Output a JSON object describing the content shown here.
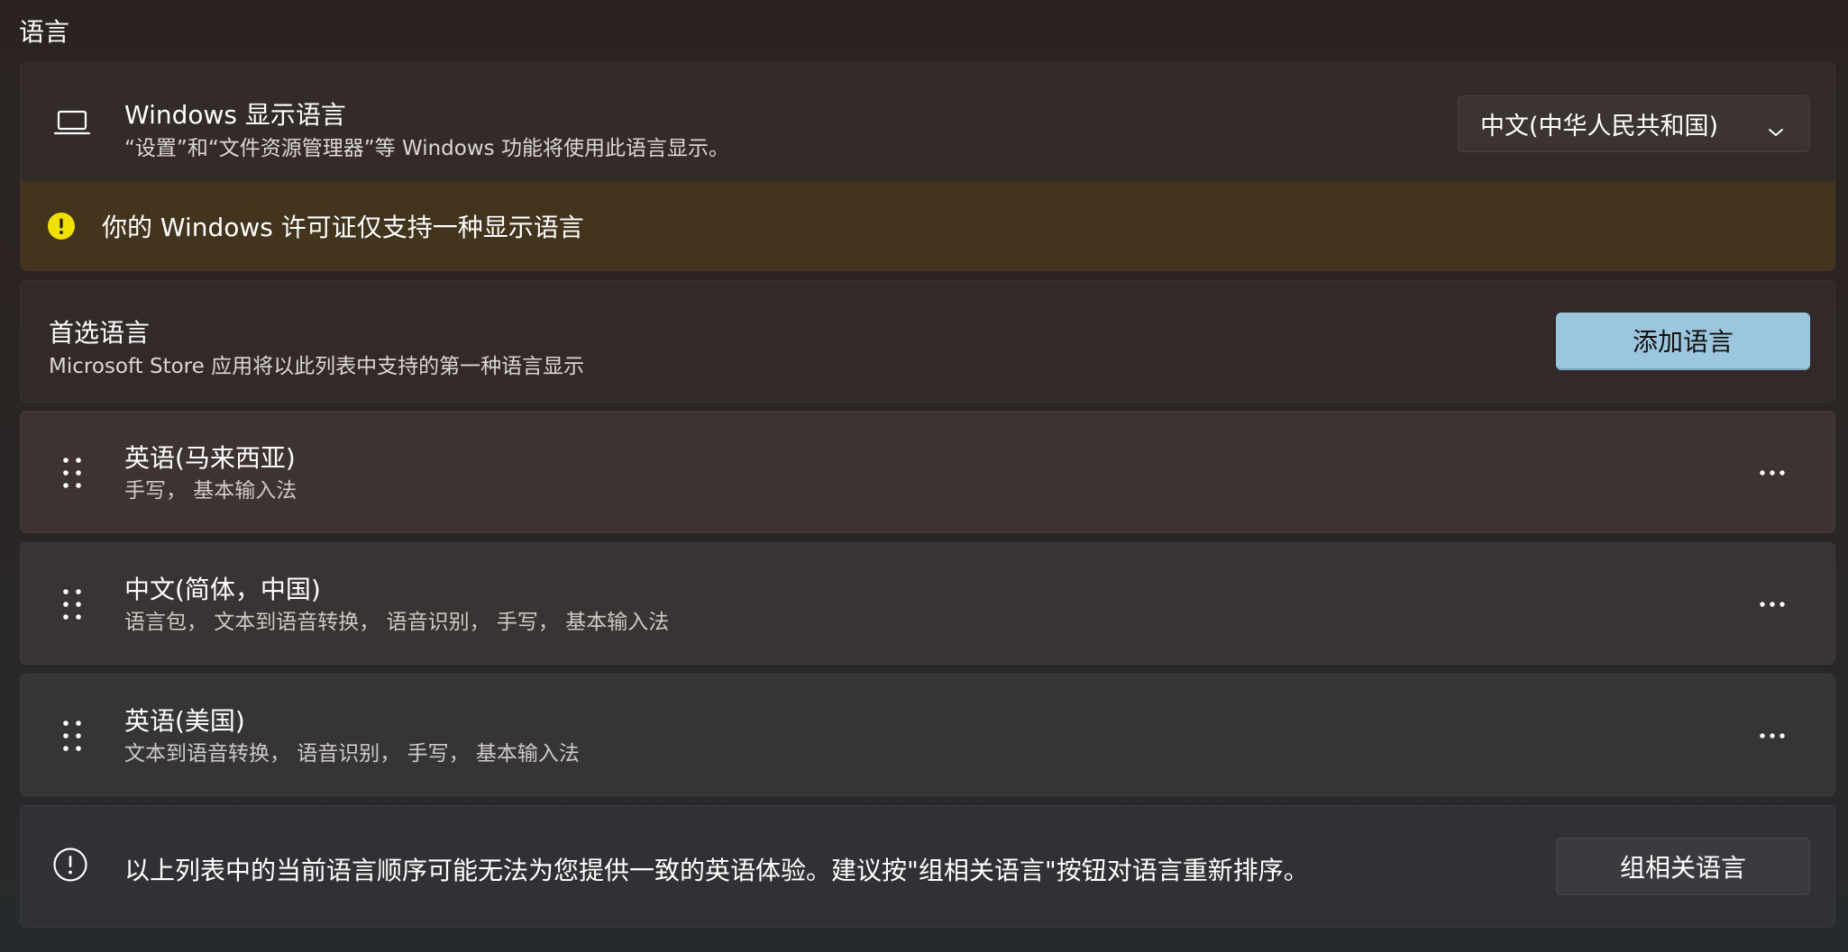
{
  "section": {
    "title": "语言"
  },
  "display_language": {
    "icon": "laptop-icon",
    "title": "Windows 显示语言",
    "description": "“设置”和“文件资源管理器”等 Windows 功能将使用此语言显示。",
    "selected": "中文(中华人民共和国)"
  },
  "license_warning": {
    "icon": "warning-icon",
    "text": "你的 Windows 许可证仅支持一种显示语言",
    "icon_color": "#f2e100"
  },
  "preferred": {
    "title": "首选语言",
    "description": "Microsoft Store 应用将以此列表中支持的第一种语言显示",
    "add_button": "添加语言",
    "accent_color": "#9cc6dd"
  },
  "languages": [
    {
      "name": "英语(马来西亚)",
      "features": "手写， 基本输入法"
    },
    {
      "name": "中文(简体，中国)",
      "features": "语言包， 文本到语音转换， 语音识别， 手写， 基本输入法"
    },
    {
      "name": "英语(美国)",
      "features": "文本到语音转换， 语音识别， 手写， 基本输入法"
    }
  ],
  "notice": {
    "icon": "info-icon",
    "text": "以上列表中的当前语言顺序可能无法为您提供一致的英语体验。建议按\"组相关语言\"按钮对语言重新排序。",
    "button": "组相关语言"
  }
}
